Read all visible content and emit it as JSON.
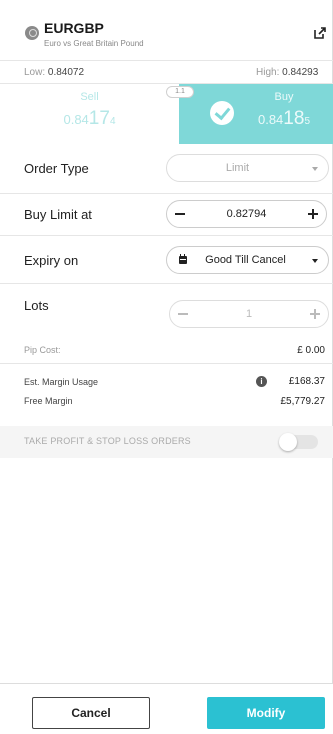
{
  "instrument": {
    "icon": "currency-icon",
    "symbol": "EURGBP",
    "description": "Euro vs Great Britain Pound"
  },
  "range": {
    "low_label": "Low:",
    "low_value": "0.84072",
    "high_label": "High:",
    "high_value": "0.84293"
  },
  "trade": {
    "sell_label": "Sell",
    "sell_price_prefix": "0.84",
    "sell_price_main": "17",
    "sell_price_suffix": "4",
    "spread": "1.1",
    "buy_label": "Buy",
    "buy_price_prefix": "0.84",
    "buy_price_main": "18",
    "buy_price_suffix": "5",
    "selected": "Buy"
  },
  "order_type": {
    "label": "Order Type",
    "value": "Limit"
  },
  "buy_limit": {
    "label": "Buy Limit at",
    "value": "0.82794"
  },
  "expiry": {
    "label": "Expiry on",
    "value": "Good Till Cancel"
  },
  "lots": {
    "label": "Lots",
    "value": "1"
  },
  "pip_cost": {
    "label": "Pip Cost:",
    "value": "£ 0.00"
  },
  "margin": {
    "usage_label": "Est. Margin Usage",
    "usage_value": "£168.37",
    "free_label": "Free Margin",
    "free_value": "£5,779.27"
  },
  "tp_sl": {
    "label": "TAKE PROFIT & STOP LOSS ORDERS",
    "enabled": false
  },
  "footer": {
    "cancel_label": "Cancel",
    "modify_label": "Modify"
  },
  "colors": {
    "accent": "#2bc1d2",
    "buy_bg": "#7fd8d8"
  }
}
